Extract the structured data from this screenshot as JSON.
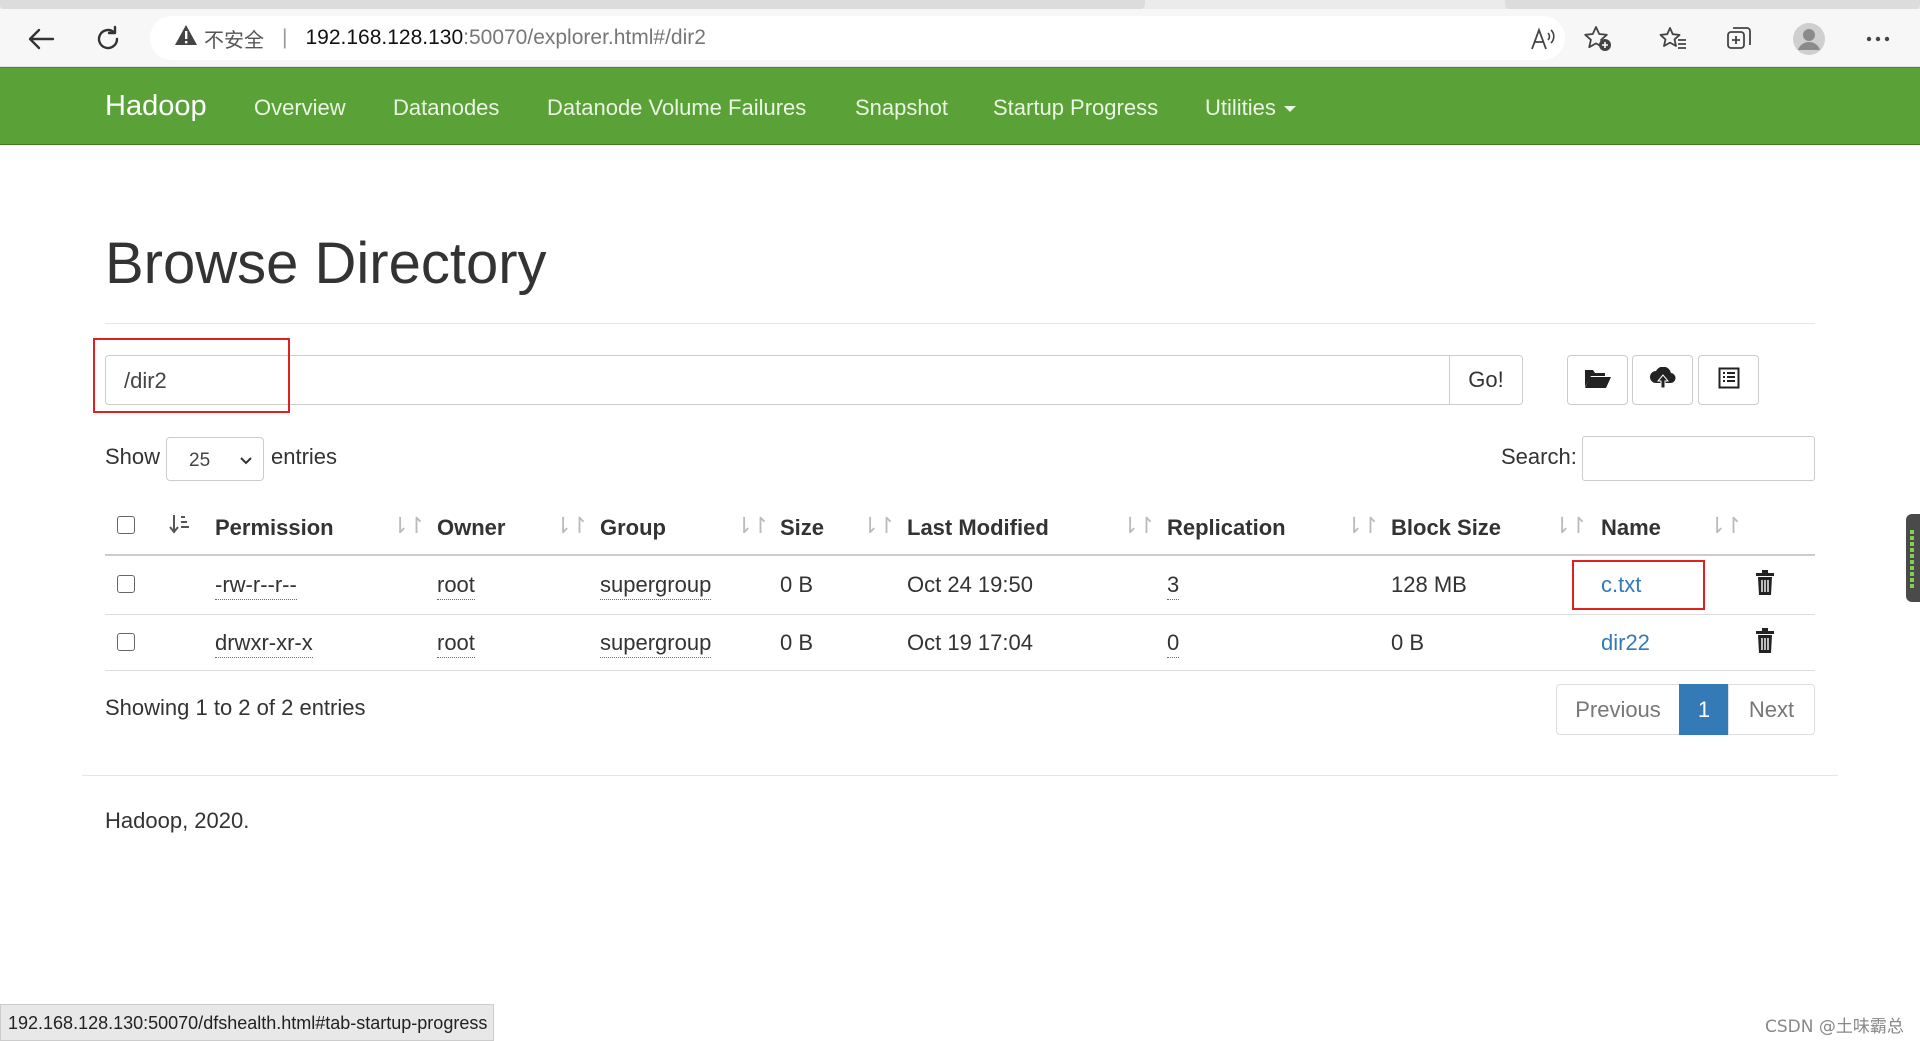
{
  "browser": {
    "insecure_label": "不安全",
    "url_host": "192.168.128.130",
    "url_rest": ":50070/explorer.html#/dir2"
  },
  "navbar": {
    "brand": "Hadoop",
    "items": [
      "Overview",
      "Datanodes",
      "Datanode Volume Failures",
      "Snapshot",
      "Startup Progress",
      "Utilities"
    ]
  },
  "page": {
    "title": "Browse Directory",
    "path_value": "/dir2",
    "go_label": "Go!",
    "show_label": "Show",
    "entries_per_page": "25",
    "entries_label": "entries",
    "search_label": "Search:"
  },
  "table": {
    "headers": [
      "Permission",
      "Owner",
      "Group",
      "Size",
      "Last Modified",
      "Replication",
      "Block Size",
      "Name"
    ],
    "rows": [
      {
        "permission": "-rw-r--r--",
        "owner": "root",
        "group": "supergroup",
        "size": "0 B",
        "modified": "Oct 24 19:50",
        "replication": "3",
        "block_size": "128 MB",
        "name": "c.txt"
      },
      {
        "permission": "drwxr-xr-x",
        "owner": "root",
        "group": "supergroup",
        "size": "0 B",
        "modified": "Oct 19 17:04",
        "replication": "0",
        "block_size": "0 B",
        "name": "dir22"
      }
    ]
  },
  "pagination": {
    "summary": "Showing 1 to 2 of 2 entries",
    "previous": "Previous",
    "current": "1",
    "next": "Next"
  },
  "footer": {
    "text": "Hadoop, 2020."
  },
  "statusbar": {
    "url": "192.168.128.130:50070/dfshealth.html#tab-startup-progress"
  },
  "watermark": "CSDN @土味霸总",
  "colors": {
    "navbar": "#5aa138",
    "link": "#337ab7",
    "highlight": "#e02020"
  },
  "icons": [
    "back-arrow-icon",
    "refresh-icon",
    "warning-icon",
    "read-aloud-icon",
    "add-favorite-icon",
    "favorites-icon",
    "collections-icon",
    "profile-icon",
    "more-icon",
    "folder-open-icon",
    "upload-icon",
    "list-icon",
    "trash-icon",
    "sort-icon"
  ]
}
